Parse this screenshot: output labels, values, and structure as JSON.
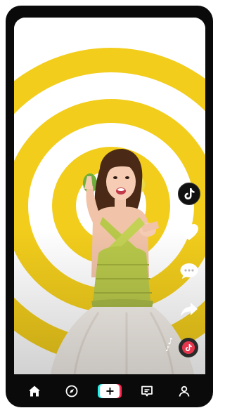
{
  "app": {
    "name": "TikTok"
  },
  "colors": {
    "frame": "#0a0a0a",
    "ring_yellow": "#f2cd1c",
    "dress_green": "#b8c84a",
    "skirt_white": "#f4efe9",
    "accent_red": "#fe2c55",
    "accent_cyan": "#25f4ee"
  },
  "side_actions": [
    {
      "name": "creator-avatar",
      "icon": "tiktok-logo-icon"
    },
    {
      "name": "like-button",
      "icon": "heart-icon"
    },
    {
      "name": "comment-button",
      "icon": "comment-bubble-icon"
    },
    {
      "name": "share-button",
      "icon": "share-arrow-icon"
    }
  ],
  "music": {
    "icon": "music-disc-icon"
  },
  "bottom_nav": {
    "items": [
      {
        "name": "home",
        "icon": "home-icon"
      },
      {
        "name": "discover",
        "icon": "compass-icon"
      },
      {
        "name": "create",
        "icon": "plus-icon",
        "label": "+"
      },
      {
        "name": "inbox",
        "icon": "message-icon"
      },
      {
        "name": "profile",
        "icon": "person-icon"
      }
    ]
  }
}
